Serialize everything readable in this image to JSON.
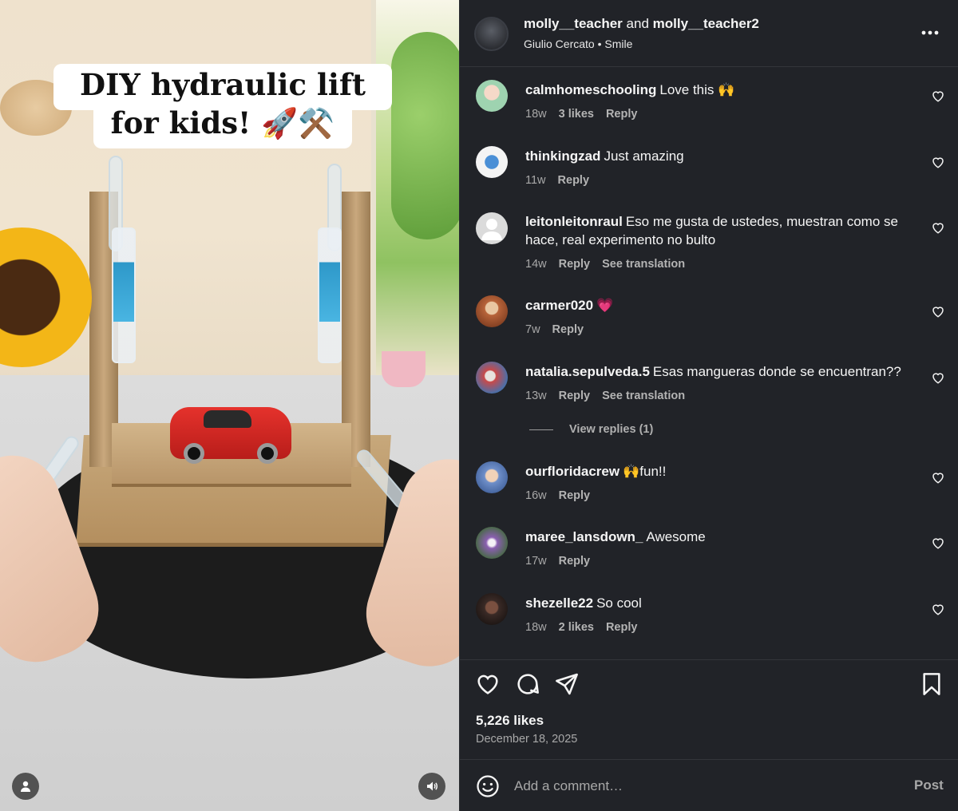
{
  "media": {
    "caption_line1": "DIY hydraulic lift",
    "caption_line2": "for kids! 🚀⚒️",
    "user_icon": "person-icon",
    "sound_icon": "speaker-icon"
  },
  "header": {
    "user1": "molly__teacher",
    "joiner": "and",
    "user2": "molly__teacher2",
    "audio": "Giulio Cercato • Smile",
    "more_icon": "more-horizontal-icon"
  },
  "comments": [
    {
      "user": "calmhomeschooling",
      "text": "Love this 🙌",
      "time": "18w",
      "likes": "3 likes",
      "reply": "Reply",
      "translate": "",
      "avatar_color": "#9ed3b0"
    },
    {
      "user": "thinkingzad",
      "text": "Just amazing",
      "time": "11w",
      "likes": "",
      "reply": "Reply",
      "translate": "",
      "avatar_color": "#f3f3f3"
    },
    {
      "user": "leitonleitonraul",
      "text": "Eso me gusta de ustedes, muestran como se hace, real experimento no bulto",
      "time": "14w",
      "likes": "",
      "reply": "Reply",
      "translate": "See translation",
      "avatar_color": "#dbdbdb"
    },
    {
      "user": "carmer020",
      "text": "💗",
      "time": "7w",
      "likes": "",
      "reply": "Reply",
      "translate": "",
      "avatar_color": "#b8643a"
    },
    {
      "user": "natalia.sepulveda.5",
      "text": "Esas mangueras donde se encuentran??",
      "time": "13w",
      "likes": "",
      "reply": "Reply",
      "translate": "See translation",
      "avatar_color": "#c94a4a"
    },
    {
      "user": "ourfloridacrew",
      "text": "🙌fun!!",
      "time": "16w",
      "likes": "",
      "reply": "Reply",
      "translate": "",
      "avatar_color": "#6f8fc9"
    },
    {
      "user": "maree_lansdown_",
      "text": "Awesome",
      "time": "17w",
      "likes": "",
      "reply": "Reply",
      "translate": "",
      "avatar_color": "#8a5fb0"
    },
    {
      "user": "shezelle22",
      "text": "So cool",
      "time": "18w",
      "likes": "2 likes",
      "reply": "Reply",
      "translate": "",
      "avatar_color": "#3a2a26"
    }
  ],
  "view_replies": "View replies (1)",
  "actions": {
    "like_icon": "heart-icon",
    "comment_icon": "comment-icon",
    "share_icon": "send-icon",
    "save_icon": "bookmark-icon",
    "likes": "5,226 likes",
    "date": "December 18, 2025"
  },
  "comment_bar": {
    "emoji_icon": "emoji-icon",
    "placeholder": "Add a comment…",
    "post_label": "Post"
  }
}
